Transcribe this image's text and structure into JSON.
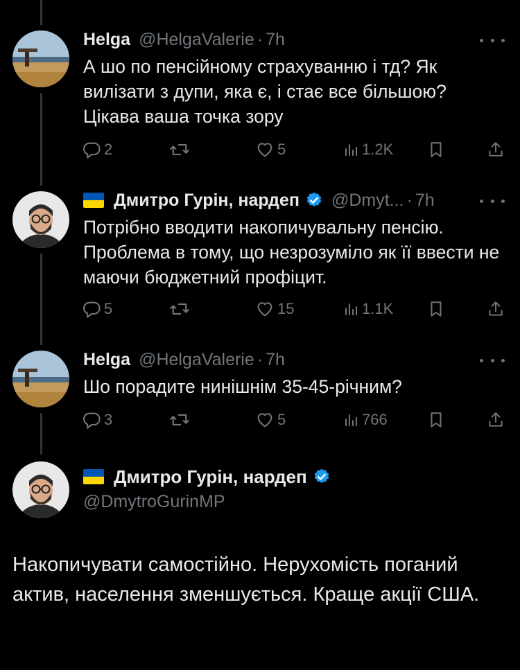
{
  "tweets": [
    {
      "name": "Helga",
      "handle": "@HelgaValerie",
      "time": "7h",
      "text": "А шо по пенсійному страхуванню і тд? Як вилізати з дупи, яка є, і стає все більшою? Цікава ваша точка зору",
      "replies": "2",
      "retweets": "",
      "likes": "5",
      "views": "1.2K"
    },
    {
      "name": "Дмитро Гурін, нардеп",
      "handle": "@Dmyt...",
      "time": "7h",
      "text": "Потрібно вводити накопичувальну пенсію. Проблема в тому, що незрозуміло як її ввести не маючи бюджетний профіцит.",
      "replies": "5",
      "retweets": "",
      "likes": "15",
      "views": "1.1K"
    },
    {
      "name": "Helga",
      "handle": "@HelgaValerie",
      "time": "7h",
      "text": "Шо порадите нинішнім 35-45-річним?",
      "replies": "3",
      "retweets": "",
      "likes": "5",
      "views": "766"
    }
  ],
  "main_tweet": {
    "name": "Дмитро Гурін, нардеп",
    "handle": "@DmytroGurinMP",
    "text": "Накопичувати самостійно. Нерухомість поганий актив, населення зменшується. Краще акції США."
  },
  "colors": {
    "background": "#000000",
    "text": "#e7e9ea",
    "muted": "#71767b",
    "verified": "#1d9bf0",
    "flag_blue": "#0057b7",
    "flag_yellow": "#ffd700"
  },
  "icons": [
    "reply-icon",
    "retweet-icon",
    "like-icon",
    "views-icon",
    "bookmark-icon",
    "share-icon",
    "more-icon",
    "verified-icon",
    "ukraine-flag-icon"
  ]
}
